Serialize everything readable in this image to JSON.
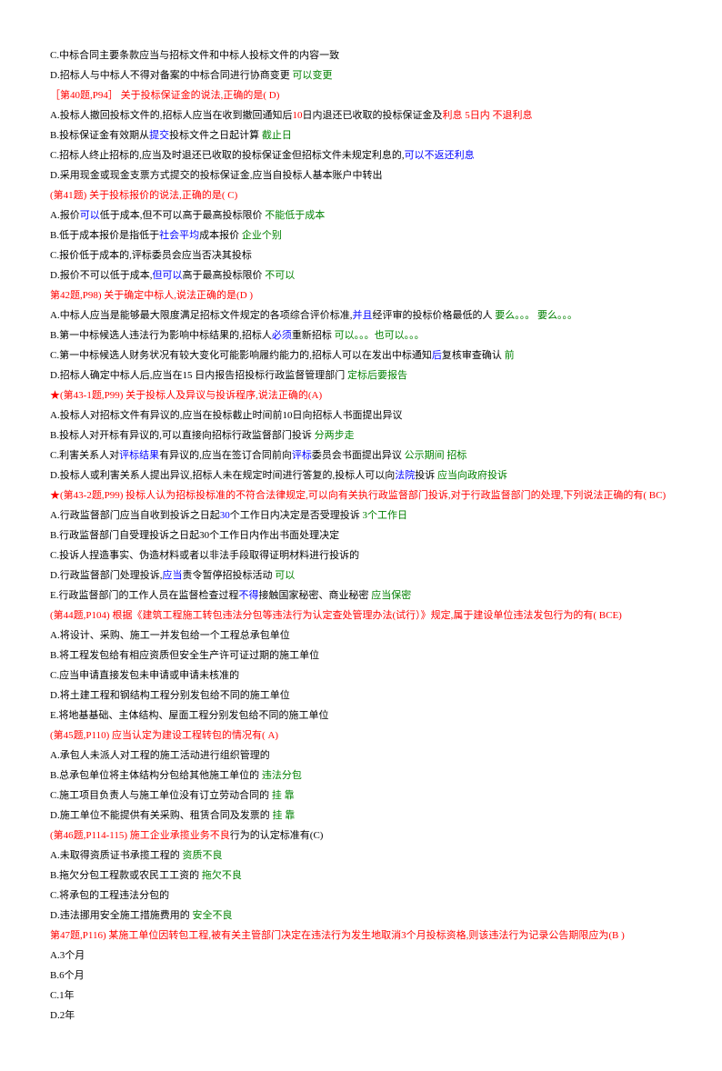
{
  "items": [
    {
      "t": "item",
      "b": "C.中标合同主要条款应当与招标文件和中标人投标文件的内容一致"
    },
    {
      "t": "item",
      "b": "D.招标人与中标人不得对备案的中标合同进行协商变更",
      "g": "  可以变更"
    },
    {
      "t": "qhead",
      "r": "［第40题,P94］ 关于投标保证金的说法,正确的是(  D)"
    },
    {
      "t": "item",
      "b": "A.投标人撤回投标文件的,招标人应当在收到撤回通知后",
      "r": "10",
      "b2": "日内退还已收取的投标保证金及",
      "r2": "利息  5日内  不退利息"
    },
    {
      "t": "item",
      "b": "B.投标保证金有效期从",
      "bl": "提交",
      "b2": "投标文件之日起计算",
      "g": "  截止日"
    },
    {
      "t": "item",
      "b": "C.招标人终止招标的,应当及时退还已收取的投标保证金但招标文件未规定利息的,",
      "bl": "可以不返还利息"
    },
    {
      "t": "item",
      "b": "D.采用现金或现金支票方式提交的投标保证金,应当自投标人基本账户中转出"
    },
    {
      "t": "qhead",
      "r": "(第41题)  关于投标报价的说法,正确的是(  C)"
    },
    {
      "t": "item",
      "b": "A.报价",
      "bl": "可以",
      "b2": "低于成本,但不可以高于最高投标限价",
      "g": "  不能低于成本"
    },
    {
      "t": "item",
      "b": "B.低于成本报价是指低于",
      "bl": "社会平均",
      "b2": "成本报价",
      "g": "  企业个别"
    },
    {
      "t": "item",
      "b": "C.报价低于成本的,评标委员会应当否决其投标"
    },
    {
      "t": "item",
      "b": "D.报价不可以低于成本,",
      "bl": "但可以",
      "b2": "高于最高投标限价",
      "g": "  不可以"
    },
    {
      "t": "qhead",
      "r": "第42题,P98)  关于确定中标人,说法正确的是(D  )"
    },
    {
      "t": "item",
      "b": "A.中标人应当是能够最大限度满足招标文件规定的各项综合评价标准,",
      "bl": "并且",
      "b2": "经评审的投标价格最低的人",
      "g": "  要么。。。 要么。。。"
    },
    {
      "t": "item",
      "b": "B.第一中标候选人违法行为影响中标结果的,招标人",
      "bl": "必须",
      "b2": "重新招标",
      "g": "  可以。。。也可以。。。"
    },
    {
      "t": "item",
      "b": "C.第一中标候选人财务状况有较大变化可能影响履约能力的,招标人可以在发出中标通知",
      "bl": "后",
      "b2": "复核审查确认",
      "g": "  前"
    },
    {
      "t": "item",
      "b": "D.招标人确定中标人后,应当在15  日内报告招投标行政监督管理部门",
      "g": "   定标后要报告"
    },
    {
      "t": "qhead",
      "star": "★",
      "r": "(第43-1题,P99)  关于投标人及异议与投诉程序,说法正确的(A)"
    },
    {
      "t": "item",
      "b": "A.投标人对招标文件有异议的,应当在投标截止时间前10日向招标人书面提出异议"
    },
    {
      "t": "item",
      "b": "B.投标人对开标有异议的,可以直接向招标行政监督部门投诉",
      "g": "   分两步走"
    },
    {
      "t": "item",
      "b": "C.利害关系人对",
      "bl": "评标结果",
      "b2": "有异议的,应当在签订合同前向",
      "bl2": "评标",
      "b3": "委员会书面提出异议",
      "g": "  公示期间  招标"
    },
    {
      "t": "item",
      "b": "D.投标人或利害关系人提出异议,招标人未在规定时间进行答复的,投标人可以向",
      "bl": "法院",
      "b2": "投诉",
      "g": "   应当向政府投诉"
    },
    {
      "t": "qhead",
      "star": "★",
      "r": "(第43-2题,P99)  投标人认为招标投标准的不符合法律规定,可以向有关执行政监督部门投诉,对于行政监督部门的处理,下列说法正确的有(  BC)"
    },
    {
      "t": "item",
      "b": "A.行政监督部门应当自收到投诉之日起",
      "bl": "30",
      "b2": "个工作日内决定是否受理投诉",
      "g": "  3个工作日"
    },
    {
      "t": "item",
      "b": "B.行政监督部门自受理投诉之日起30个工作日内作出书面处理决定"
    },
    {
      "t": "item",
      "b": "C.投诉人捏造事实、伪造材料或者以非法手段取得证明材料进行投诉的"
    },
    {
      "t": "item",
      "b": "D.行政监督部门处理投诉,",
      "bl": "应当",
      "b2": "责令暂停招投标活动",
      "g": "   可以"
    },
    {
      "t": "item",
      "b": "E.行政监督部门的工作人员在监督检查过程",
      "bl": "不得",
      "b2": "接触国家秘密、商业秘密",
      "g": "   应当保密"
    },
    {
      "t": "qhead",
      "r": " (第44题,P104)  根据《建筑工程施工转包违法分包等违法行为认定查处管理办法(试行）》规定,属于建设单位违法发包行为的有(  BCE)"
    },
    {
      "t": "item",
      "b": "A.将设计、采购、施工一并发包给一个工程总承包单位"
    },
    {
      "t": "item",
      "b": "B.将工程发包给有相应资质但安全生产许可证过期的施工单位"
    },
    {
      "t": "item",
      "b": "C.应当申请直接发包未申请或申请未核准的"
    },
    {
      "t": "item",
      "b": "D.将土建工程和钢结构工程分别发包给不同的施工单位"
    },
    {
      "t": "item",
      "b": "E.将地基基础、主体结构、屋面工程分别发包给不同的施工单位"
    },
    {
      "t": "qhead",
      "r": " (第45题,P110)  应当认定为建设工程转包的情况有(  A)"
    },
    {
      "t": "item",
      "b": "A.承包人未派人对工程的施工活动进行组织管理的"
    },
    {
      "t": "item",
      "b": "B.总承包单位将主体结构分包给其他施工单位的",
      "g": "  违法分包"
    },
    {
      "t": "item",
      "b": "C.施工项目负责人与施工单位没有订立劳动合同的",
      "g": "  挂 靠"
    },
    {
      "t": "item",
      "b": "D.施工单位不能提供有关采购、租赁合同及发票的",
      "g": "  挂 靠"
    },
    {
      "t": "qhead",
      "r": "  (第46题,P114-115)  施工企业承揽业务不良",
      "b": "行为的认定标准有(C)"
    },
    {
      "t": "item",
      "b": "A.未取得资质证书承揽工程的",
      "g": "    资质不良"
    },
    {
      "t": "item",
      "b": "B.拖欠分包工程款或农民工工资的",
      "g": "   拖欠不良"
    },
    {
      "t": "item",
      "b": "C.将承包的工程违法分包的"
    },
    {
      "t": "item",
      "b": "D.违法挪用安全施工措施费用的",
      "g": "   安全不良"
    },
    {
      "t": "qhead",
      "r": "第47题,P116)  某施工单位因转包工程,被有关主管部门决定在违法行为发生地取消3个月投标资格,则该违法行为记录公告期限应为(B  )"
    },
    {
      "t": "item",
      "b": "A.3个月"
    },
    {
      "t": "item",
      "b": "B.6个月"
    },
    {
      "t": "item",
      "b": "C.1年"
    },
    {
      "t": "item",
      "b": "D.2年"
    }
  ]
}
